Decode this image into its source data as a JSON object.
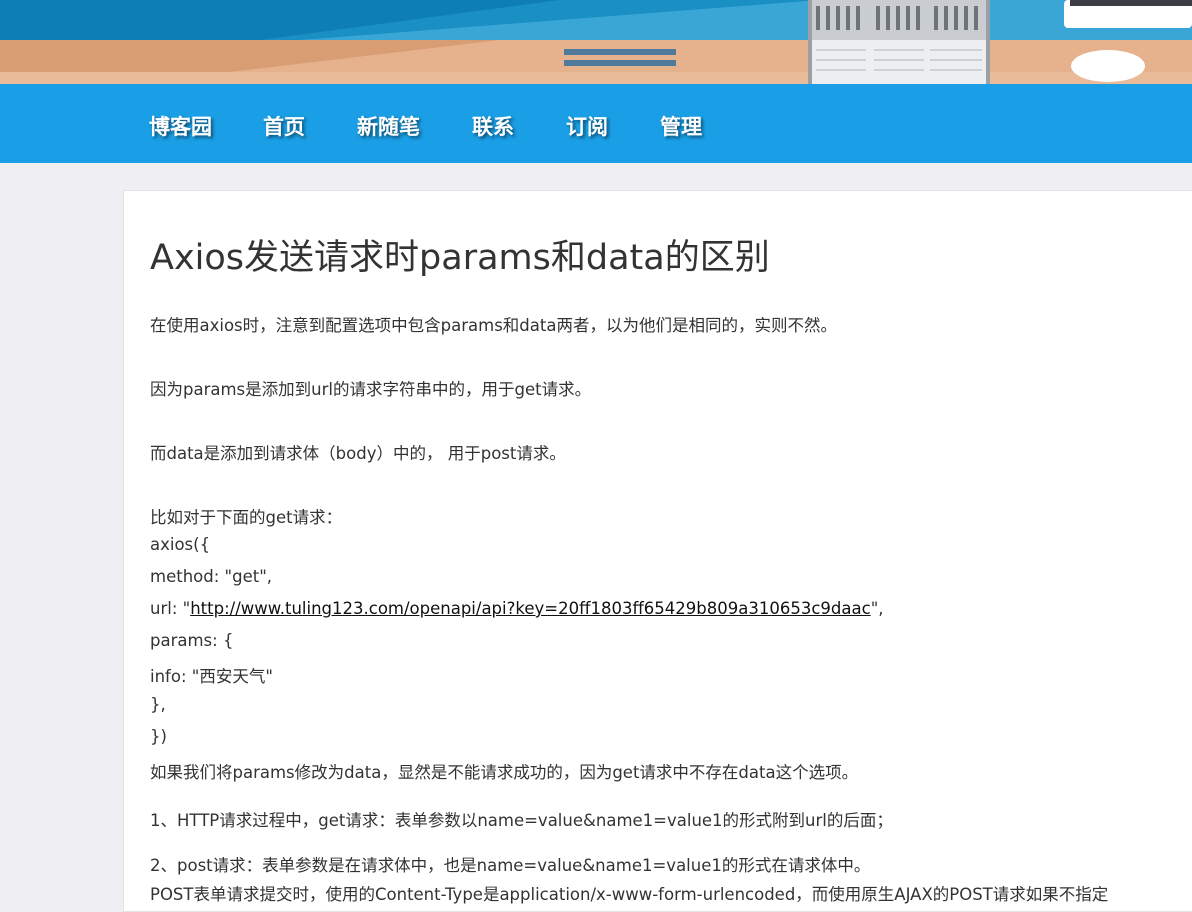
{
  "nav": {
    "items": [
      "博客园",
      "首页",
      "新随笔",
      "联系",
      "订阅",
      "管理"
    ]
  },
  "post": {
    "title": "Axios发送请求时params和data的区别",
    "intro": "在使用axios时，注意到配置选项中包含params和data两者，以为他们是相同的，实则不然。",
    "params_line": "因为params是添加到url的请求字符串中的，用于get请求。",
    "data_line": "而data是添加到请求体（body）中的， 用于post请求。",
    "example_intro": "比如对于下面的get请求：",
    "code": {
      "l1": "axios({",
      "l2": "method: \"get\",",
      "url_prefix": "url: \"",
      "url_link": "http://www.tuling123.com/openapi/api?key=20ff1803ff65429b809a310653c9daac",
      "url_suffix": "\",",
      "l4": "params: {",
      "l5": "info: \"西安天气\"",
      "l6": "},",
      "l7": "})"
    },
    "conclusion": "如果我们将params修改为data，显然是不能请求成功的，因为get请求中不存在data这个选项。",
    "point1": "1、HTTP请求过程中，get请求：表单参数以name=value&name1=value1的形式附到url的后面；",
    "point2": "2、post请求：表单参数是在请求体中，也是name=value&name1=value1的形式在请求体中。",
    "point3": "POST表单请求提交时，使用的Content-Type是application/x-www-form-urlencoded，而使用原生AJAX的POST请求如果不指定"
  },
  "colors": {
    "nav_bg": "#1a9fe6",
    "banner_sky": "#1f93c9",
    "banner_desk": "#e2ad85",
    "page_bg": "#eeeef3"
  }
}
